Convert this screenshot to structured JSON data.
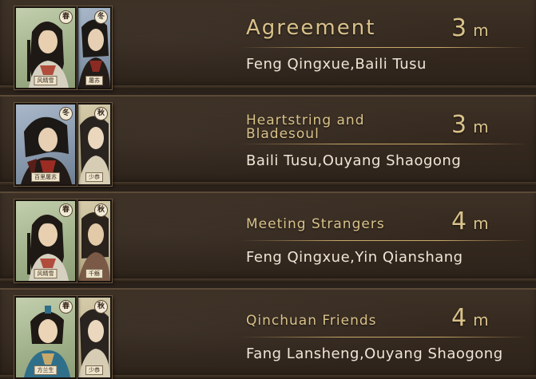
{
  "rows": [
    {
      "title": "Agreement",
      "duration_value": "3",
      "duration_unit": "m",
      "characters": "Feng Qingxue,Baili Tusu",
      "main_card": {
        "season_badge": "春",
        "nameplate": "风晴雪",
        "theme": "spring"
      },
      "sub_card": {
        "season_badge": "冬",
        "nameplate": "屠苏",
        "theme": "winter"
      }
    },
    {
      "title": "Heartstring and Bladesoul",
      "duration_value": "3",
      "duration_unit": "m",
      "characters": "Baili Tusu,Ouyang Shaogong",
      "main_card": {
        "season_badge": "冬",
        "nameplate": "百里屠苏",
        "theme": "winter"
      },
      "sub_card": {
        "season_badge": "秋",
        "nameplate": "少恭",
        "theme": "autumn"
      }
    },
    {
      "title": "Meeting Strangers",
      "duration_value": "4",
      "duration_unit": "m",
      "characters": "Feng Qingxue,Yin Qianshang",
      "main_card": {
        "season_badge": "春",
        "nameplate": "风晴雪",
        "theme": "spring"
      },
      "sub_card": {
        "season_badge": "秋",
        "nameplate": "千觞",
        "theme": "autumn"
      }
    },
    {
      "title": "Qinchuan Friends",
      "duration_value": "4",
      "duration_unit": "m",
      "characters": "Fang Lansheng,Ouyang Shaogong",
      "main_card": {
        "season_badge": "春",
        "nameplate": "方兰生",
        "theme": "spring"
      },
      "sub_card": {
        "season_badge": "秋",
        "nameplate": "少恭",
        "theme": "autumn"
      }
    }
  ],
  "colors": {
    "title_gold": "#d9c28a",
    "text_light": "#efe6d6",
    "panel_dark": "#2d231a",
    "divider_gold": "#c9a96a"
  }
}
